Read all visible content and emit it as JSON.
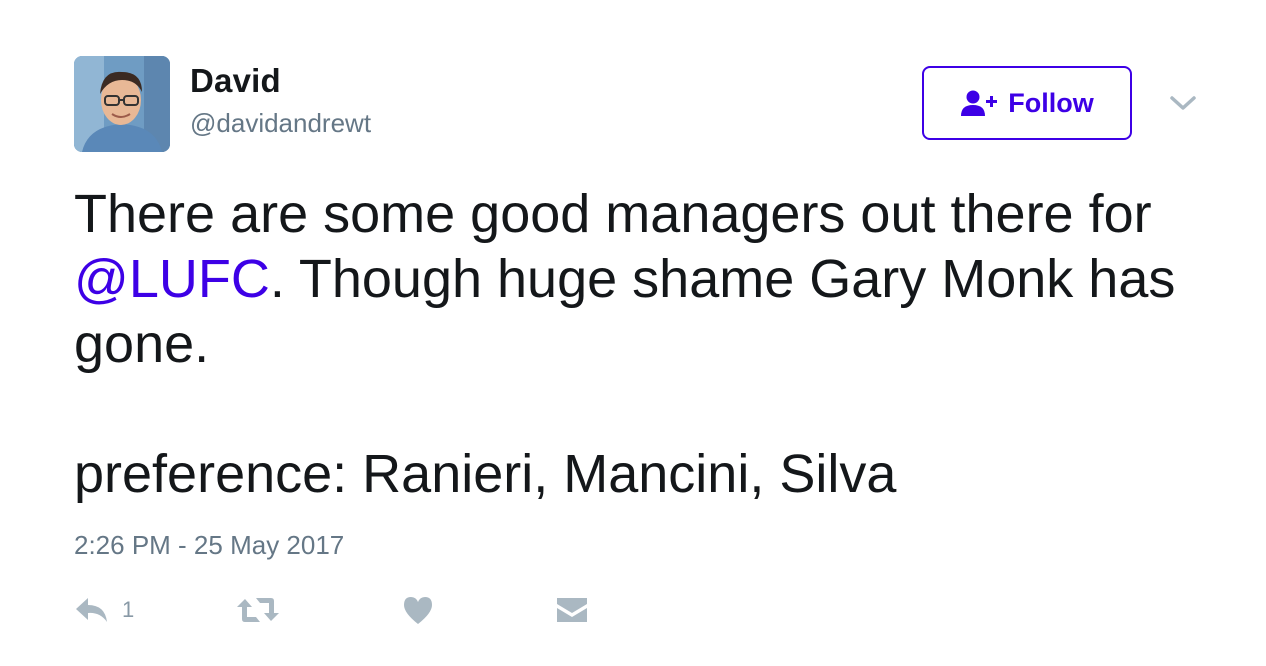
{
  "user": {
    "display_name": "David",
    "handle": "@davidandrewt"
  },
  "follow_button": {
    "label": "Follow",
    "icon": "add-user-icon"
  },
  "menu": {
    "icon": "chevron-down-icon"
  },
  "tweet": {
    "line1": "There are some good managers out there for",
    "mention": "@LUFC",
    "line2_rest": ".  Though huge shame Gary Monk has gone.",
    "line3": "preference: Ranieri,  Mancini, Silva"
  },
  "timestamp": "2:26 PM - 25 May 2017",
  "actions": {
    "reply_count": "1",
    "icons": [
      "reply-icon",
      "retweet-icon",
      "like-icon",
      "message-icon"
    ]
  },
  "colors": {
    "accent": "#3d00e6",
    "text": "#14171a",
    "secondary": "#657786",
    "icon": "#aab8c2"
  }
}
